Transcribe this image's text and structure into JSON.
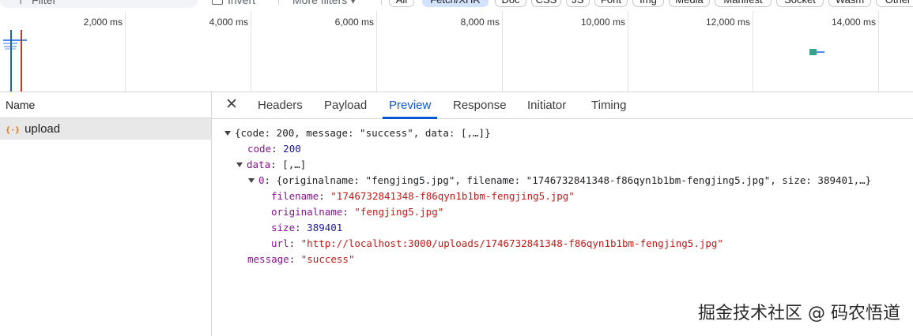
{
  "filterbar": {
    "filter_placeholder": "Filter",
    "invert_label": "Invert",
    "more_filters_label": "More filters",
    "chips": [
      "All",
      "Fetch/XHR",
      "Doc",
      "CSS",
      "JS",
      "Font",
      "Img",
      "Media",
      "Manifest",
      "Socket",
      "Wasm",
      "Other"
    ],
    "active_chip": "Fetch/XHR"
  },
  "overview": {
    "ticks": [
      "2,000 ms",
      "4,000 ms",
      "6,000 ms",
      "8,000 ms",
      "10,000 ms",
      "12,000 ms",
      "14,000 ms"
    ]
  },
  "left": {
    "name_header": "Name",
    "request_icon": "{·}",
    "request_name": "upload"
  },
  "tabs": {
    "close_icon": "✕",
    "items": [
      "Headers",
      "Payload",
      "Preview",
      "Response",
      "Initiator",
      "Timing"
    ],
    "active": "Preview"
  },
  "preview": {
    "root": "{code: 200, message: \"success\", data: [,…]}",
    "code_key": "code",
    "code_value": "200",
    "data_key": "data",
    "data_summary": "[,…]",
    "item0_key": "0",
    "item0_summary": "{originalname: \"fengjing5.jpg\", filename: \"1746732841348-f86qyn1b1bm-fengjing5.jpg\", size: 389401,…}",
    "filename_key": "filename",
    "filename_value": "\"1746732841348-f86qyn1b1bm-fengjing5.jpg\"",
    "originalname_key": "originalname",
    "originalname_value": "\"fengjing5.jpg\"",
    "size_key": "size",
    "size_value": "389401",
    "url_key": "url",
    "url_value": "\"http://localhost:3000/uploads/1746732841348-f86qyn1b1bm-fengjing5.jpg\"",
    "message_key": "message",
    "message_value": "\"success\""
  },
  "watermark": "掘金技术社区 @ 码农悟道",
  "colors": {
    "accent": "#0b57d0",
    "active_chip_bg": "#d3e3fd",
    "string": "#c41a16",
    "number": "#1a1aa6"
  }
}
